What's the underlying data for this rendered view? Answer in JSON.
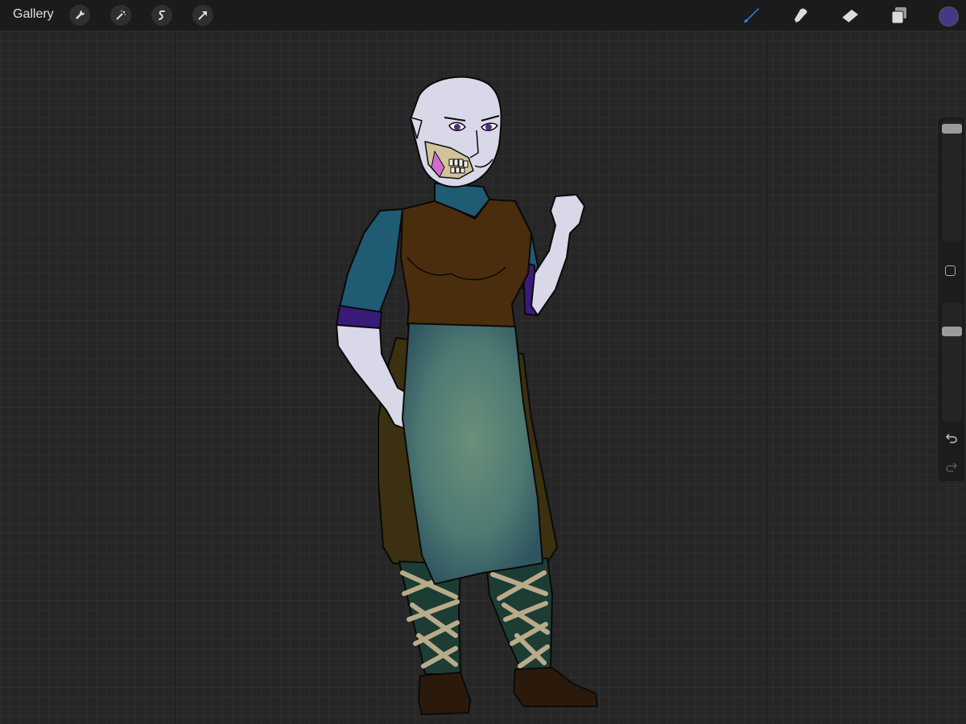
{
  "topbar": {
    "gallery_label": "Gallery",
    "left_tools": [
      "wrench-icon",
      "magic-wand-icon",
      "selection-icon",
      "transform-arrow-icon"
    ],
    "right_tools": [
      "brush-icon",
      "smudge-icon",
      "eraser-icon",
      "layers-icon"
    ],
    "active_tool": "brush-icon",
    "current_color": "#423a86"
  },
  "sidebar": {
    "brush_size_level": 0.04,
    "opacity_level": 0.22,
    "controls": [
      "modify-square-icon",
      "undo-icon",
      "redo-icon"
    ]
  },
  "canvas": {
    "background_color": "#262626",
    "grid": true,
    "artwork": "character-illustration"
  },
  "colors": {
    "accent_blue": "#1e8bff",
    "skin": "#d9d8e8",
    "tunic": "#1f5b73",
    "vest": "#4a2d0c",
    "apron": "#4e7a73",
    "skirt": "#3b300f",
    "cuffs": "#3a1a78",
    "leggings": "#1d3d34",
    "bindings": "#b9ab8a",
    "boots": "#2b1a0c"
  }
}
